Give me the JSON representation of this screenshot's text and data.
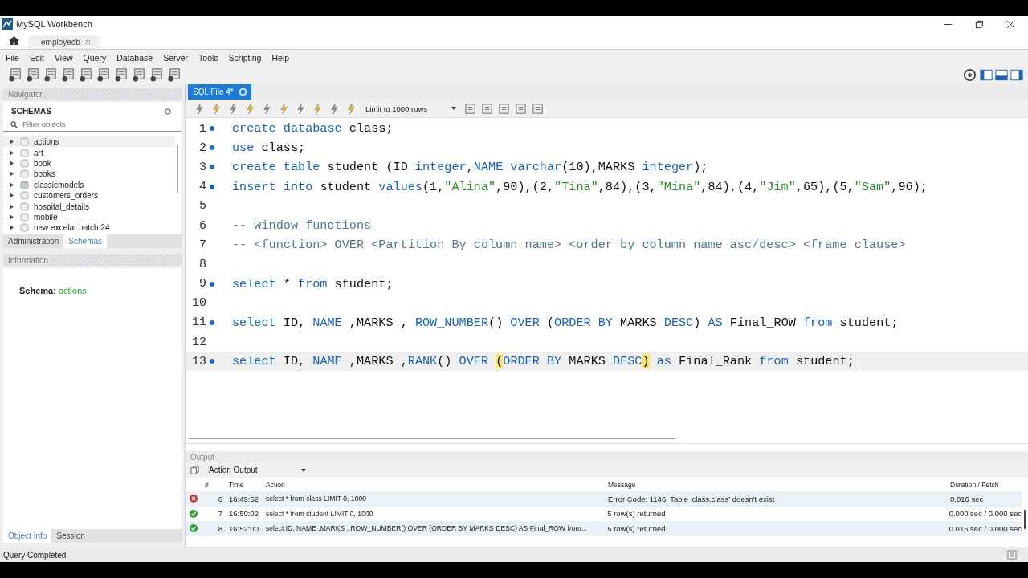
{
  "window": {
    "title": "MySQL Workbench"
  },
  "connection_tabs": [
    {
      "label": "employedb",
      "selected": true
    }
  ],
  "menu": [
    "File",
    "Edit",
    "View",
    "Query",
    "Database",
    "Server",
    "Tools",
    "Scripting",
    "Help"
  ],
  "navigator": {
    "title": "Navigator",
    "section": "SCHEMAS",
    "filter": {
      "placeholder": "Filter objects"
    },
    "schemas": [
      {
        "name": "actions",
        "selected": true,
        "kind": "plain"
      },
      {
        "name": "art",
        "selected": false,
        "kind": "plain"
      },
      {
        "name": "book",
        "selected": false,
        "kind": "plain"
      },
      {
        "name": "books",
        "selected": false,
        "kind": "plain"
      },
      {
        "name": "classicmodels",
        "selected": false,
        "kind": "strong"
      },
      {
        "name": "customers_orders",
        "selected": false,
        "kind": "plain"
      },
      {
        "name": "hospital_details",
        "selected": false,
        "kind": "plain"
      },
      {
        "name": "mobile",
        "selected": false,
        "kind": "plain"
      },
      {
        "name": "new excelar batch 24",
        "selected": false,
        "kind": "plain"
      }
    ],
    "tabs": [
      {
        "label": "Administration",
        "selected": false
      },
      {
        "label": "Schemas",
        "selected": true
      }
    ]
  },
  "information": {
    "title": "Information",
    "label": "Schema:",
    "value": "actions"
  },
  "bottom_tabs": [
    {
      "label": "Object Info",
      "selected": true
    },
    {
      "label": "Session",
      "selected": false
    }
  ],
  "editor": {
    "tab": {
      "label": "SQL File 4*"
    },
    "limit": "Limit to 1000 rows",
    "lines": [
      {
        "number": "1",
        "statement": true,
        "current": false,
        "tokens": [
          {
            "kind": "kw",
            "text": "create database"
          },
          {
            "kind": "plain",
            "text": " class;"
          }
        ]
      },
      {
        "number": "2",
        "statement": true,
        "current": false,
        "tokens": [
          {
            "kind": "kw",
            "text": "use"
          },
          {
            "kind": "plain",
            "text": " class;"
          }
        ]
      },
      {
        "number": "3",
        "statement": true,
        "current": false,
        "tokens": [
          {
            "kind": "kw",
            "text": "create table"
          },
          {
            "kind": "plain",
            "text": " student (ID "
          },
          {
            "kind": "kw",
            "text": "integer"
          },
          {
            "kind": "plain",
            "text": ","
          },
          {
            "kind": "kw",
            "text": "NAME varchar"
          },
          {
            "kind": "plain",
            "text": "(10),MARKS "
          },
          {
            "kind": "kw",
            "text": "integer"
          },
          {
            "kind": "plain",
            "text": ");"
          }
        ]
      },
      {
        "number": "4",
        "statement": true,
        "current": false,
        "tokens": [
          {
            "kind": "kw",
            "text": "insert into"
          },
          {
            "kind": "plain",
            "text": " student "
          },
          {
            "kind": "kw",
            "text": "values"
          },
          {
            "kind": "plain",
            "text": "(1,"
          },
          {
            "kind": "str",
            "text": "\"Alina\""
          },
          {
            "kind": "plain",
            "text": ",90),(2,"
          },
          {
            "kind": "str",
            "text": "\"Tina\""
          },
          {
            "kind": "plain",
            "text": ",84),(3,"
          },
          {
            "kind": "str",
            "text": "\"Mina\""
          },
          {
            "kind": "plain",
            "text": ",84),(4,"
          },
          {
            "kind": "str",
            "text": "\"Jim\""
          },
          {
            "kind": "plain",
            "text": ",65),(5,"
          },
          {
            "kind": "str",
            "text": "\"Sam\""
          },
          {
            "kind": "plain",
            "text": ",96);"
          }
        ]
      },
      {
        "number": "5",
        "statement": false,
        "current": false
      },
      {
        "number": "6",
        "statement": false,
        "current": false,
        "tokens": [
          {
            "kind": "comment",
            "text": "-- window functions"
          }
        ]
      },
      {
        "number": "7",
        "statement": false,
        "current": false,
        "tokens": [
          {
            "kind": "comment",
            "text": "-- <function> OVER <Partition By column name> <order by column name asc/desc> <frame clause>"
          }
        ]
      },
      {
        "number": "8",
        "statement": false,
        "current": false
      },
      {
        "number": "9",
        "statement": true,
        "current": false,
        "tokens": [
          {
            "kind": "kw",
            "text": "select"
          },
          {
            "kind": "plain",
            "text": " * "
          },
          {
            "kind": "kw",
            "text": "from"
          },
          {
            "kind": "plain",
            "text": " student;"
          }
        ]
      },
      {
        "number": "10",
        "statement": false,
        "current": false
      },
      {
        "number": "11",
        "statement": true,
        "current": false,
        "tokens": [
          {
            "kind": "kw",
            "text": "select"
          },
          {
            "kind": "plain",
            "text": " ID, "
          },
          {
            "kind": "kw",
            "text": "NAME"
          },
          {
            "kind": "plain",
            "text": " ,MARKS , "
          },
          {
            "kind": "kw",
            "text": "ROW_NUMBER"
          },
          {
            "kind": "plain",
            "text": "() "
          },
          {
            "kind": "kw",
            "text": "OVER"
          },
          {
            "kind": "plain",
            "text": " ("
          },
          {
            "kind": "kw",
            "text": "ORDER BY"
          },
          {
            "kind": "plain",
            "text": " MARKS "
          },
          {
            "kind": "kw",
            "text": "DESC"
          },
          {
            "kind": "plain",
            "text": ") "
          },
          {
            "kind": "kw",
            "text": "AS"
          },
          {
            "kind": "plain",
            "text": " Final_ROW "
          },
          {
            "kind": "kw",
            "text": "from"
          },
          {
            "kind": "plain",
            "text": " student;"
          }
        ]
      },
      {
        "number": "12",
        "statement": false,
        "current": false
      },
      {
        "number": "13",
        "statement": true,
        "current": true,
        "tokens": [
          {
            "kind": "kw",
            "text": "select"
          },
          {
            "kind": "plain",
            "text": " ID, "
          },
          {
            "kind": "kw",
            "text": "NAME"
          },
          {
            "kind": "plain",
            "text": " ,MARKS ,"
          },
          {
            "kind": "kw",
            "text": "RANK"
          },
          {
            "kind": "plain",
            "text": "() "
          },
          {
            "kind": "kw",
            "text": "OVER "
          },
          {
            "kind": "match",
            "text": "("
          },
          {
            "kind": "kw",
            "text": "ORDER BY"
          },
          {
            "kind": "plain",
            "text": " MARKS "
          },
          {
            "kind": "kw",
            "text": "DESC"
          },
          {
            "kind": "match",
            "text": ")"
          },
          {
            "kind": "kw",
            "text": " as"
          },
          {
            "kind": "plain",
            "text": " Final_Rank "
          },
          {
            "kind": "kw",
            "text": "from"
          },
          {
            "kind": "plain",
            "text": " student;"
          }
        ]
      }
    ]
  },
  "output": {
    "title": "Output",
    "mode": "Action Output",
    "columns": [
      "#",
      "Time",
      "Action",
      "Message",
      "Duration / Fetch"
    ],
    "rows": [
      {
        "kind": "error",
        "number": "6",
        "time": "16:49:52",
        "action": "select * from class LIMIT 0, 1000",
        "message": "Error Code: 1146. Table 'class.class' doesn't exist",
        "duration": "0.016 sec"
      },
      {
        "kind": "ok",
        "number": "7",
        "time": "16:50:02",
        "action": "select * from student LIMIT 0, 1000",
        "message": "5 row(s) returned",
        "duration": "0.000 sec / 0.000 sec"
      },
      {
        "kind": "ok",
        "number": "8",
        "time": "16:52:00",
        "action": "select ID, NAME ,MARKS , ROW_NUMBER() OVER (ORDER BY MARKS DESC) AS Final_ROW from...",
        "message": "5 row(s) returned",
        "duration": "0.016 sec / 0.000 sec"
      }
    ]
  },
  "status_bar": "Query Completed"
}
